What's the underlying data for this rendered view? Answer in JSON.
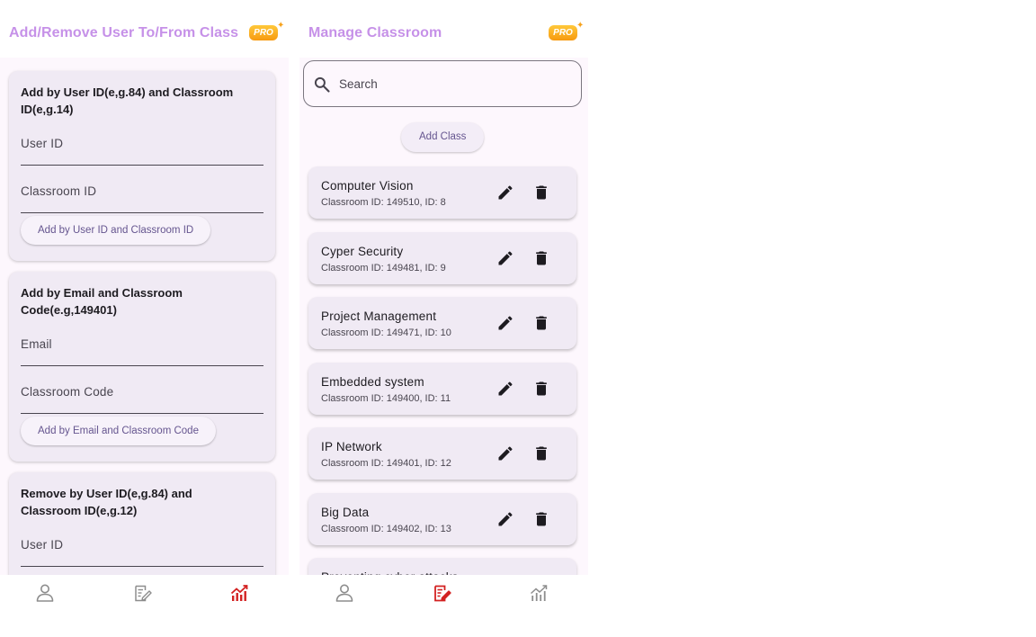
{
  "left_screen": {
    "title": "Add/Remove User To/From Class",
    "pro_badge": "PRO",
    "cards": [
      {
        "heading": "Add by User ID(e,g.84) and Classroom ID(e,g.14)",
        "fields": [
          "User ID",
          "Classroom ID"
        ],
        "button": "Add by User ID and Classroom ID"
      },
      {
        "heading": "Add by Email and Classroom Code(e.g,149401)",
        "fields": [
          "Email",
          "Classroom Code"
        ],
        "button": "Add by Email and Classroom Code"
      },
      {
        "heading": "Remove by User ID(e,g.84) and Classroom ID(e,g.12)",
        "fields": [
          "User ID"
        ]
      }
    ],
    "nav": {
      "items": [
        "profile-icon",
        "assignment-icon",
        "analytics-icon"
      ],
      "active": 2
    }
  },
  "right_screen": {
    "title": "Manage Classroom",
    "pro_badge": "PRO",
    "search": {
      "placeholder": "Search",
      "value": ""
    },
    "add_button": "Add Class",
    "classes": [
      {
        "name": "Computer Vision",
        "detail": "Classroom ID: 149510, ID: 8"
      },
      {
        "name": "Cyper Security",
        "detail": "Classroom ID: 149481, ID: 9"
      },
      {
        "name": "Project Management",
        "detail": "Classroom ID: 149471, ID: 10"
      },
      {
        "name": "Embedded system",
        "detail": "Classroom ID: 149400, ID: 11"
      },
      {
        "name": "IP Network",
        "detail": "Classroom ID: 149401, ID: 12"
      },
      {
        "name": "Big Data",
        "detail": "Classroom ID: 149402, ID: 13"
      },
      {
        "name": "Preventing cyber attacks",
        "detail": ""
      }
    ],
    "nav": {
      "items": [
        "profile-icon",
        "assignment-icon",
        "analytics-icon"
      ],
      "active": 1
    }
  },
  "colors": {
    "title": "#c691e8",
    "accent_button_text": "#65558f",
    "card_bg": "#f0eaf4",
    "nav_active": "#d32121",
    "nav_inactive": "#8d8d8d",
    "pro_badge": "#f7a21b"
  }
}
